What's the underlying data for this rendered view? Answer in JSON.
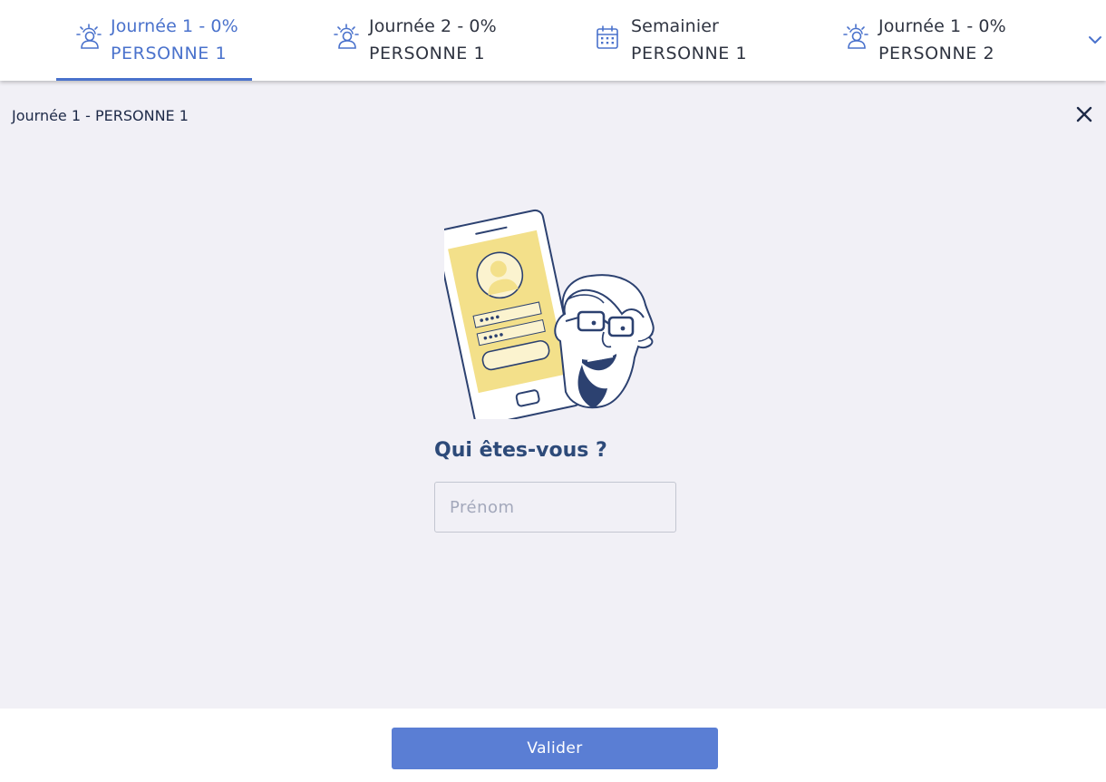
{
  "tabs": [
    {
      "icon": "sun-person-icon",
      "title": "Journée 1 - 0%",
      "subtitle": "PERSONNE 1",
      "active": true
    },
    {
      "icon": "sun-person-icon",
      "title": "Journée 2 - 0%",
      "subtitle": "PERSONNE 1",
      "active": false
    },
    {
      "icon": "calendar-icon",
      "title": "Semainier",
      "subtitle": "PERSONNE 1",
      "active": false
    },
    {
      "icon": "sun-person-icon",
      "title": "Journée 1 - 0%",
      "subtitle": "PERSONNE 2",
      "active": false
    }
  ],
  "more_tabs_icon": "chevron-down-icon",
  "page": {
    "heading": "Journée 1 - PERSONNE 1",
    "close_icon": "close-icon"
  },
  "form": {
    "question": "Qui êtes-vous ?",
    "firstname_value": "",
    "firstname_placeholder": "Prénom"
  },
  "footer": {
    "submit_label": "Valider"
  },
  "colors": {
    "accent": "#4a72cc",
    "button": "#5a7ed4",
    "background": "#f1f0f6",
    "heading_text": "#2d4a79",
    "illustration_yellow": "#f3e08a",
    "illustration_navy": "#2c4170"
  }
}
